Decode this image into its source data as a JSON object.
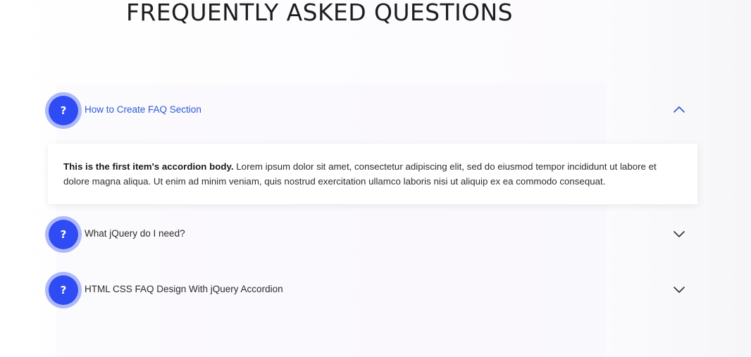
{
  "page": {
    "title": "FREQUENTLY ASKED QUESTIONS"
  },
  "colors": {
    "badge_outer": "#aeb9f7",
    "badge_inner": "#2f4cf4",
    "active_question": "#2a5ad6",
    "text": "#2b2b2b"
  },
  "faq": {
    "badge_symbol": "?",
    "items": [
      {
        "question": "How to Create FAQ Section",
        "expanded": true,
        "chevron_icon": "chevron-up-icon",
        "answer_strong": "This is the first item's accordion body.",
        "answer_text": " Lorem ipsum dolor sit amet, consectetur adipiscing elit, sed do eiusmod tempor incididunt ut labore et dolore magna aliqua. Ut enim ad minim veniam, quis nostrud exercitation ullamco laboris nisi ut aliquip ex ea commodo consequat."
      },
      {
        "question": "What jQuery do I need?",
        "expanded": false,
        "chevron_icon": "chevron-down-icon"
      },
      {
        "question": "HTML CSS FAQ Design With jQuery Accordion",
        "expanded": false,
        "chevron_icon": "chevron-down-icon"
      }
    ]
  }
}
